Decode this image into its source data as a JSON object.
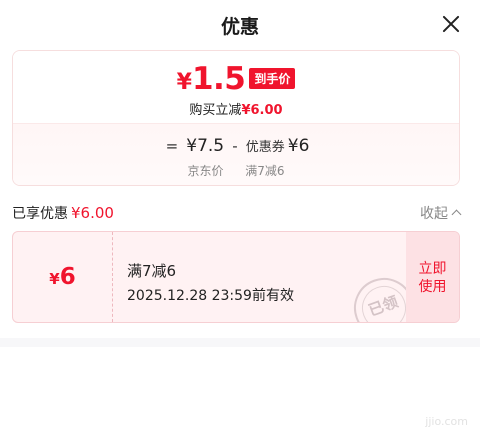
{
  "header": {
    "title": "优惠"
  },
  "price": {
    "currency": "¥",
    "final": "1.5",
    "final_tag": "到手价",
    "reduce_text": "购买立减",
    "reduce_amount": "¥6.00"
  },
  "calc": {
    "eq": "=",
    "base": "¥7.5",
    "minus": "-",
    "coupon_label": "优惠券",
    "coupon_amount": "¥6",
    "label_base": "京东价",
    "label_coupon": "满7减6"
  },
  "enjoyed": {
    "label": "已享优惠",
    "amount": "¥6.00",
    "collapse": "收起"
  },
  "coupon": {
    "currency": "¥",
    "amount": "6",
    "condition": "满7减6",
    "valid_until": "2025.12.28 23:59前有效",
    "stamp": "已领",
    "use_line1": "立即",
    "use_line2": "使用"
  },
  "watermark": "jjio.com"
}
